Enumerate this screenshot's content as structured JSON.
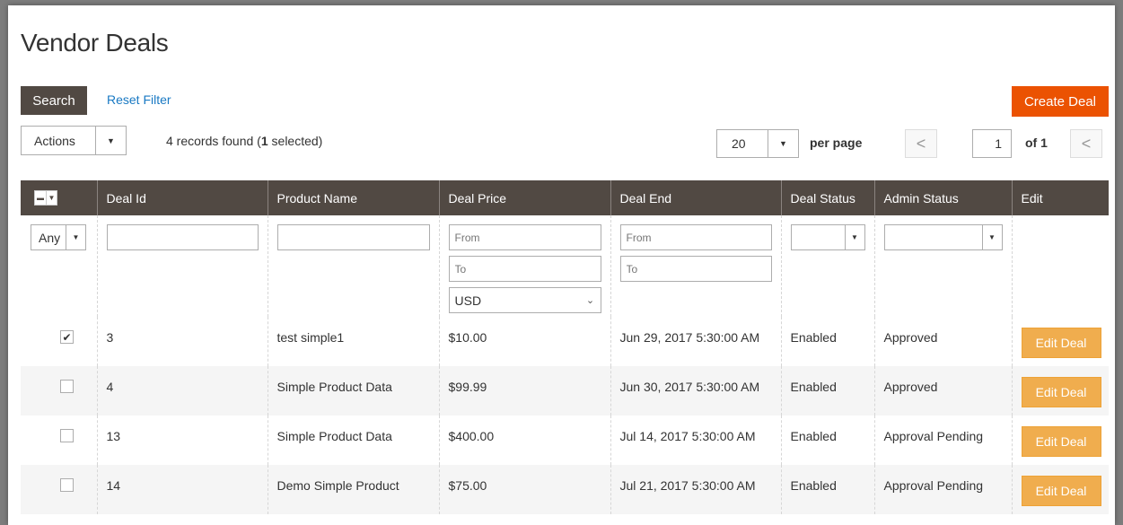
{
  "page": {
    "title": "Vendor Deals"
  },
  "toolbar": {
    "search_label": "Search",
    "reset_filter_label": "Reset Filter",
    "create_deal_label": "Create Deal",
    "actions_label": "Actions",
    "records_count_text": "4 records found (",
    "records_selected": "1",
    "records_selected_suffix": " selected)",
    "per_page_value": "20",
    "per_page_label": "per page",
    "current_page": "1",
    "page_of": "of 1",
    "prev_glyph": "<",
    "next_glyph": "<"
  },
  "columns": [
    "Deal Id",
    "Product Name",
    "Deal Price",
    "Deal End",
    "Deal Status",
    "Admin Status",
    "Edit"
  ],
  "filters": {
    "any_value": "Any",
    "price_from_placeholder": "From",
    "price_to_placeholder": "To",
    "currency_value": "USD",
    "date_from_placeholder": "From",
    "date_to_placeholder": "To"
  },
  "rows": [
    {
      "checked": true,
      "deal_id": "3",
      "product": "test simple1",
      "price": "$10.00",
      "deal_end": "Jun 29, 2017 5:30:00 AM",
      "deal_status": "Enabled",
      "admin_status": "Approved",
      "edit_label": "Edit Deal"
    },
    {
      "checked": false,
      "deal_id": "4",
      "product": "Simple Product Data",
      "price": "$99.99",
      "deal_end": "Jun 30, 2017 5:30:00 AM",
      "deal_status": "Enabled",
      "admin_status": "Approved",
      "edit_label": "Edit Deal"
    },
    {
      "checked": false,
      "deal_id": "13",
      "product": "Simple Product Data",
      "price": "$400.00",
      "deal_end": "Jul 14, 2017 5:30:00 AM",
      "deal_status": "Enabled",
      "admin_status": "Approval Pending",
      "edit_label": "Edit Deal"
    },
    {
      "checked": false,
      "deal_id": "14",
      "product": "Demo Simple Product",
      "price": "$75.00",
      "deal_end": "Jul 21, 2017 5:30:00 AM",
      "deal_status": "Enabled",
      "admin_status": "Approval Pending",
      "edit_label": "Edit Deal"
    }
  ],
  "colors": {
    "header_bg": "#514943",
    "create_button": "#eb5202",
    "edit_button": "#f0ad4e",
    "link": "#1979c3"
  }
}
